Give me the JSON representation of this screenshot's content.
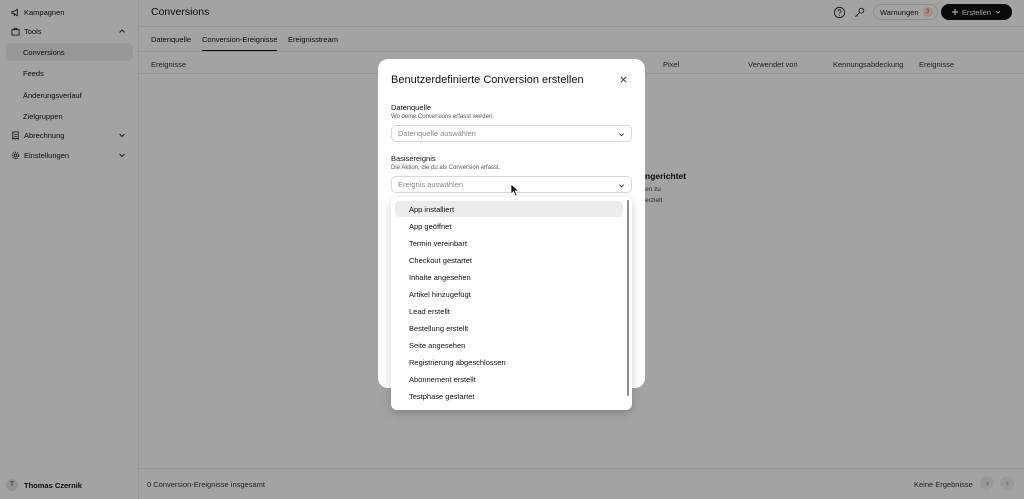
{
  "sidebar": {
    "items": [
      {
        "label": "Kampagnen",
        "icon": "megaphone-icon"
      },
      {
        "label": "Tools",
        "icon": "toolbox-icon"
      },
      {
        "label": "Conversions"
      },
      {
        "label": "Feeds"
      },
      {
        "label": "Änderungsverlauf"
      },
      {
        "label": "Zielgruppen"
      },
      {
        "label": "Abrechnung",
        "icon": "receipt-icon"
      },
      {
        "label": "Einstellungen",
        "icon": "gear-icon"
      }
    ],
    "user": {
      "initial": "T",
      "name": "Thomas Czernik"
    }
  },
  "header": {
    "title": "Conversions",
    "warnings_label": "Warnungen",
    "warnings_count": "3",
    "create_label": "Erstellen"
  },
  "tabs": [
    "Datenquelle",
    "Conversion-Ereignisse",
    "Ereignisstream"
  ],
  "table": {
    "columns": [
      "Ereignisse",
      "Pixel",
      "Verwendet von",
      "Kennungsabdeckung",
      "Ereignisse"
    ]
  },
  "empty_state": {
    "title_fragment": "ngerichtet",
    "line1_fragment": "en zu",
    "line2_fragment": "erzielt"
  },
  "footer": {
    "count_text": "0 Conversion-Ereignisse insgesamt",
    "no_results": "Keine Ergebnisse"
  },
  "modal": {
    "title": "Benutzerdefinierte Conversion erstellen",
    "datasource": {
      "label": "Datenquelle",
      "hint": "Wo deine Conversions erfasst werden.",
      "placeholder": "Datenquelle auswählen"
    },
    "base_event": {
      "label": "Basisereignis",
      "hint": "Die Aktion, die du als Conversion erfasst.",
      "placeholder": "Ereignis auswählen"
    },
    "options": [
      "App installiert",
      "App geöffnet",
      "Termin vereinbart",
      "Checkout gestartet",
      "Inhalte angesehen",
      "Artikel hinzugefügt",
      "Lead erstellt",
      "Bestellung erstellt",
      "Seite angesehen",
      "Registrierung abgeschlossen",
      "Abonnement erstellt",
      "Testphase gestartet"
    ],
    "hovered_option": "App installiert"
  }
}
